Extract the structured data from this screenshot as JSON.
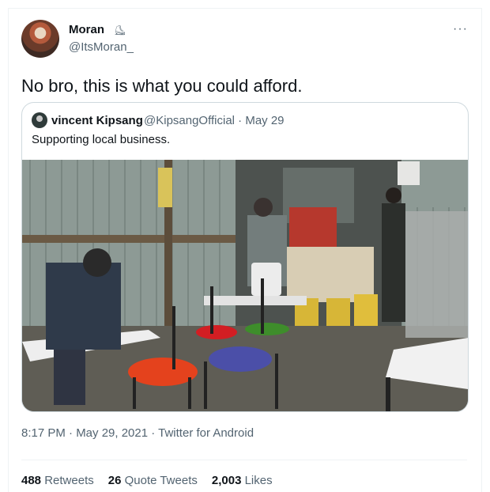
{
  "tweet": {
    "display_name": "Moran",
    "badge_icon": "verified-like-shoe-icon",
    "handle": "@ItsMoran_",
    "more_label": "···",
    "text": "No bro, this is what you could afford.",
    "timestamp": "8:17 PM · May 29, 2021 · Twitter for Android"
  },
  "quote": {
    "display_name": "vincent Kipsang",
    "handle_date": "@KipsangOfficial · May 29",
    "text": "Supporting local business."
  },
  "stats": {
    "retweets_count": "488",
    "retweets_label": "Retweets",
    "quotes_count": "26",
    "quotes_label": "Quote Tweets",
    "likes_count": "2,003",
    "likes_label": "Likes"
  }
}
